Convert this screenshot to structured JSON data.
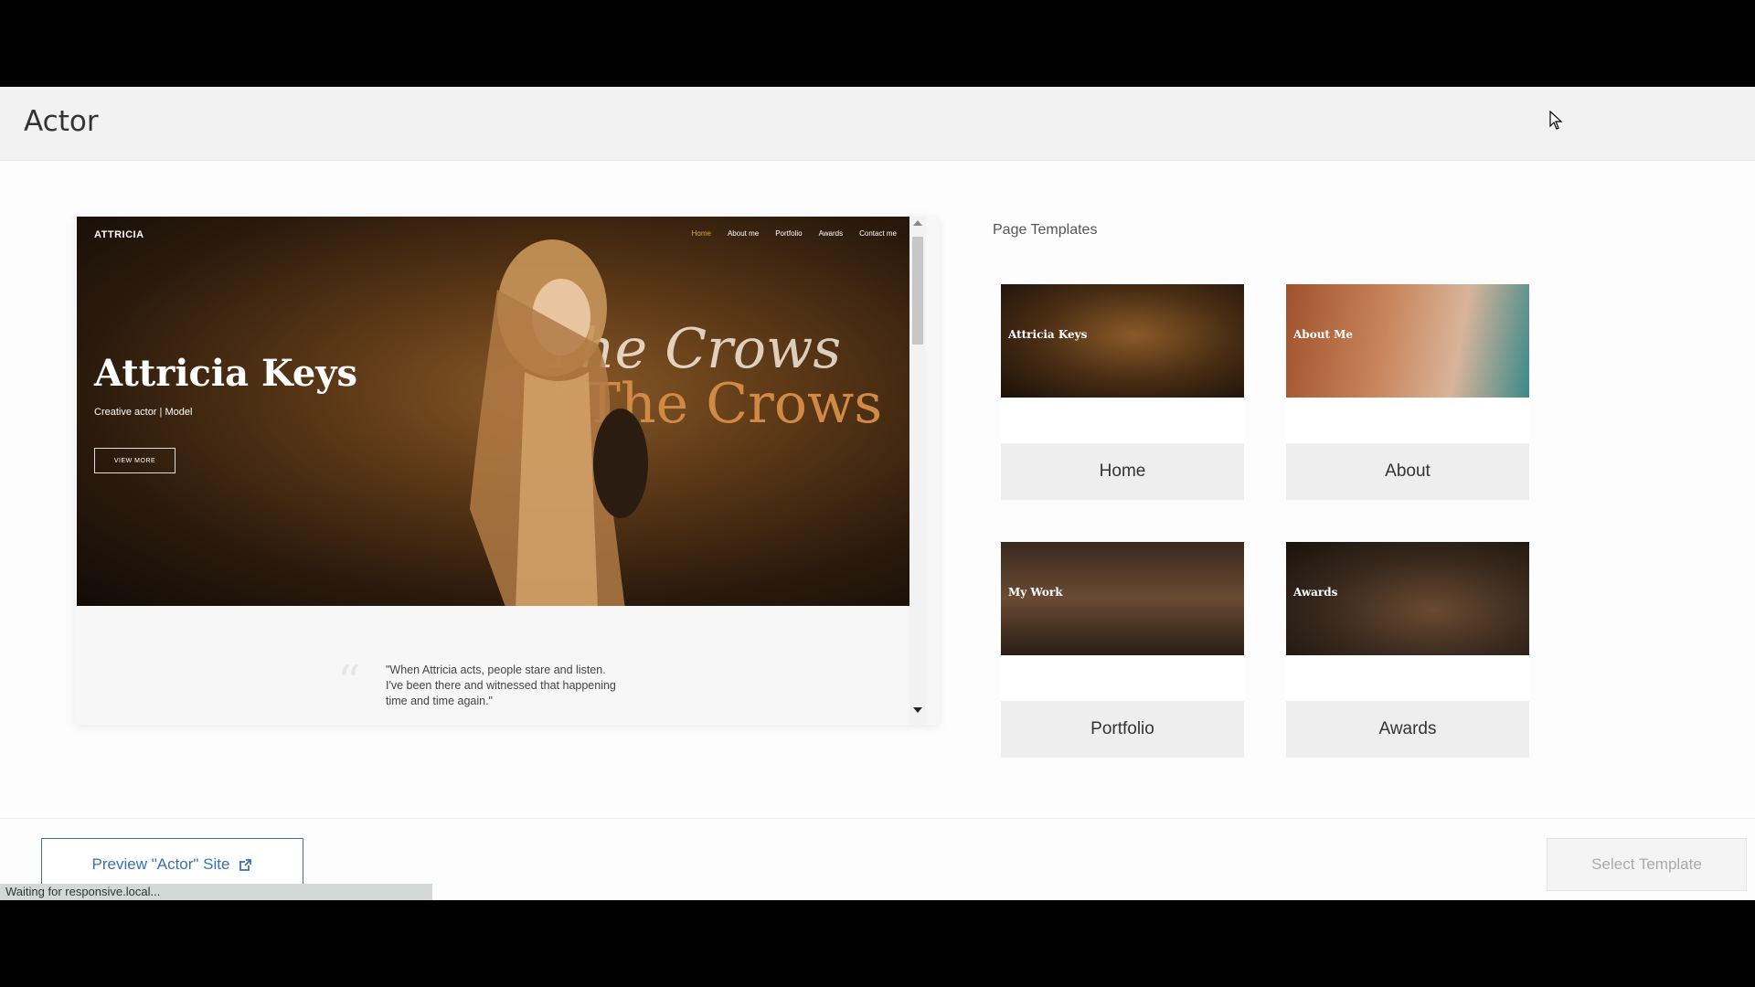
{
  "header": {
    "title": "Actor"
  },
  "preview": {
    "site": {
      "brand": "ATTRICIA",
      "nav": [
        "Home",
        "About me",
        "Portfolio",
        "Awards",
        "Contact me"
      ],
      "name": "Attricia Keys",
      "subtitle": "Creative actor | Model",
      "button": "VIEW MORE",
      "crows_line1": "The Crows",
      "crows_line2": "The Crows",
      "quote": "\"When Attricia acts, people stare and listen. I've been there and witnessed that happening time and time again.\""
    }
  },
  "templates": {
    "heading": "Page Templates",
    "items": [
      {
        "label": "Home",
        "thumb_title": "Attricia Keys"
      },
      {
        "label": "About",
        "thumb_title": "About Me"
      },
      {
        "label": "Portfolio",
        "thumb_title": "My Work"
      },
      {
        "label": "Awards",
        "thumb_title": "Awards"
      }
    ]
  },
  "footer": {
    "preview_label": "Preview \"Actor\" Site",
    "select_label": "Select Template",
    "status": "Waiting for responsive.local..."
  },
  "colors": {
    "accent": "#3a6fb0",
    "hero_gold": "#d08a46"
  },
  "icons": {
    "external": "external-link-icon",
    "cursor": "mouse-cursor-icon"
  }
}
